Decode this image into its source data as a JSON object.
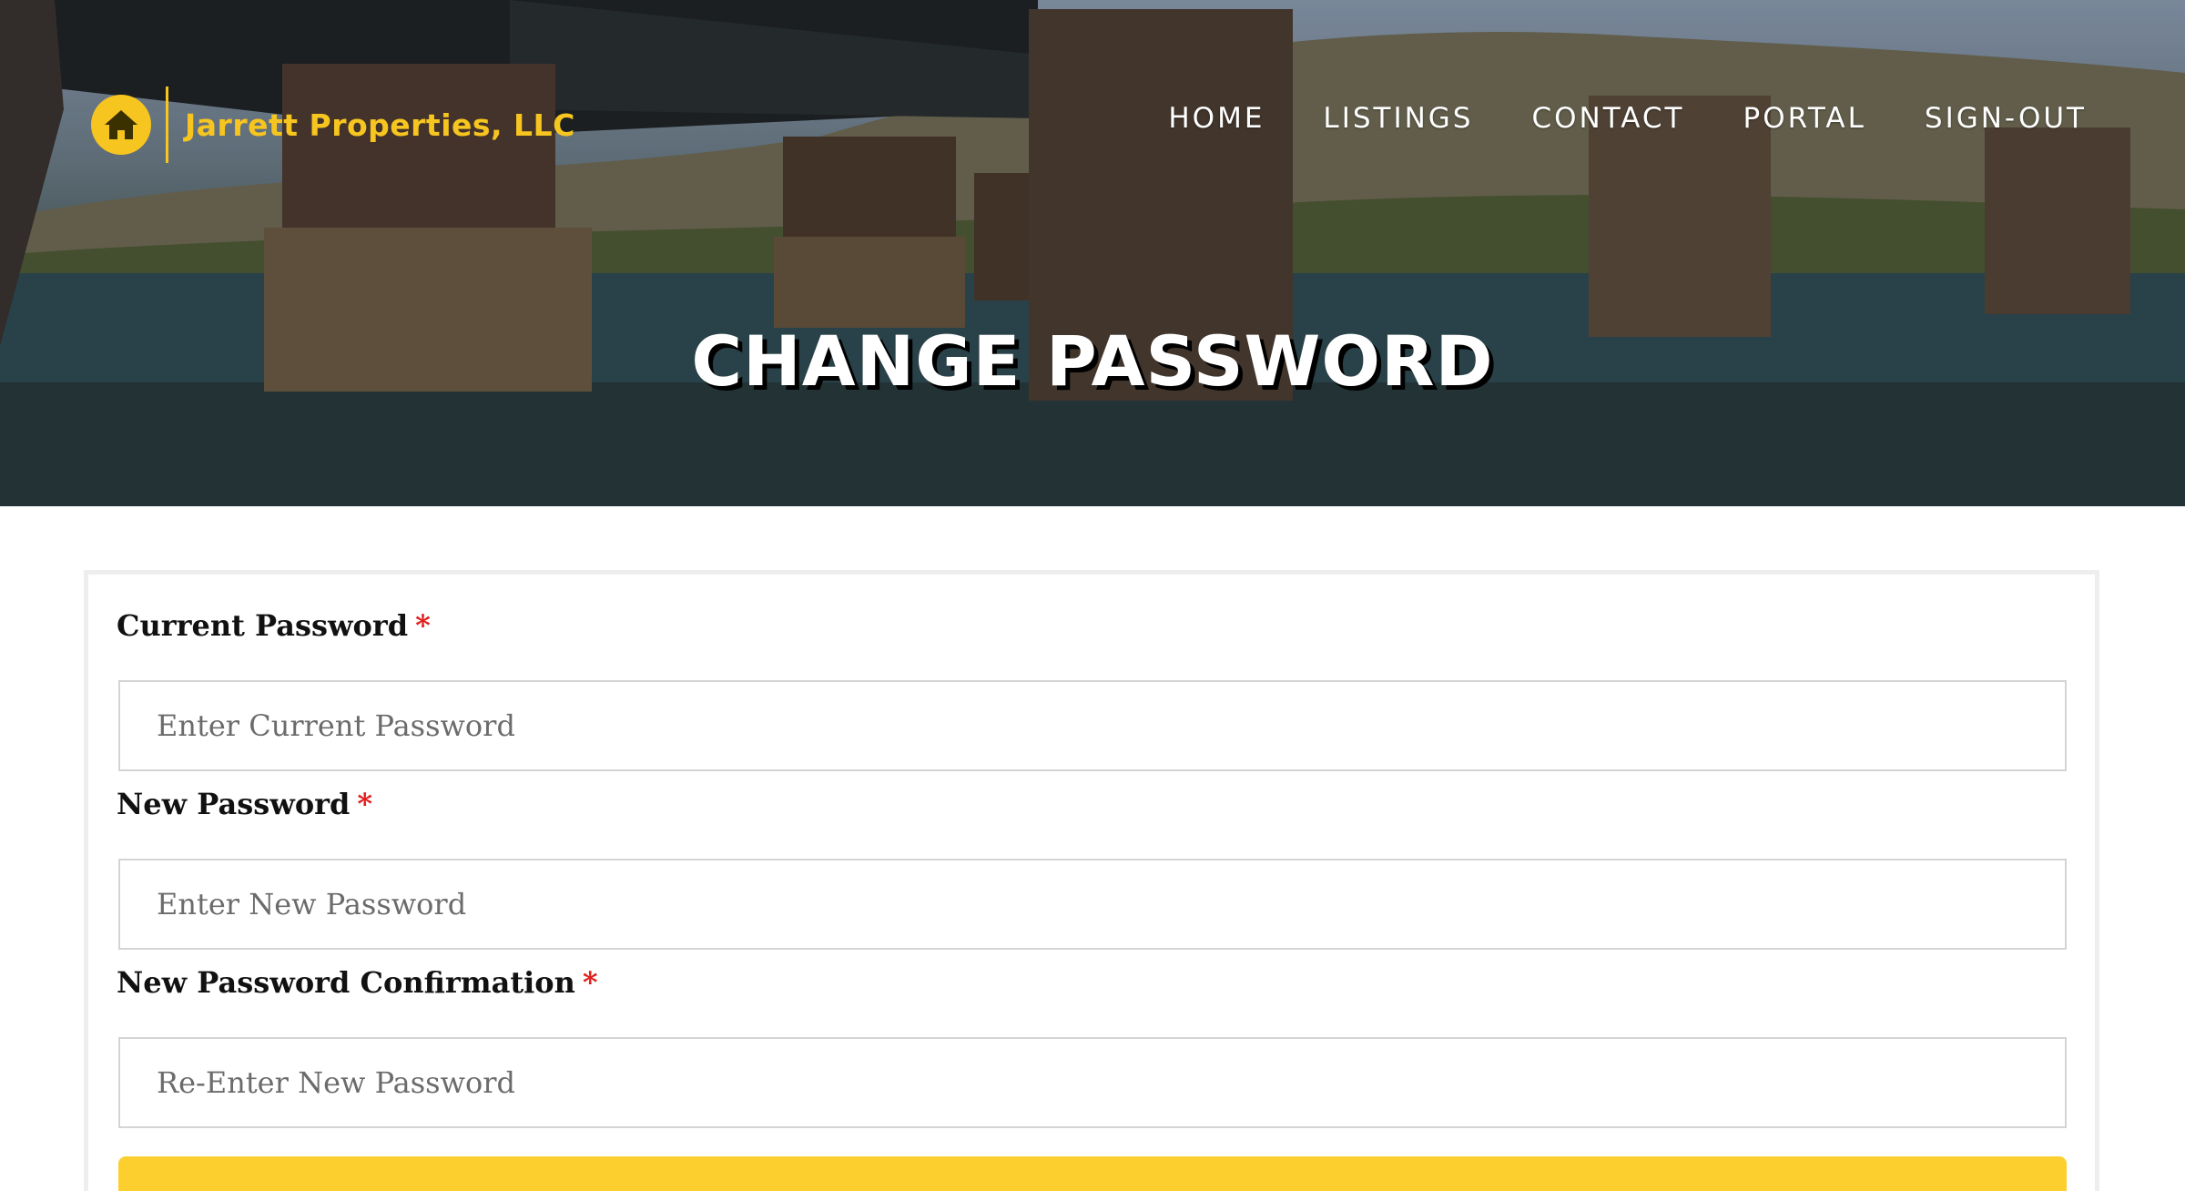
{
  "brand": {
    "name": "Jarrett Properties, LLC"
  },
  "nav": {
    "items": [
      {
        "label": "HOME"
      },
      {
        "label": "LISTINGS"
      },
      {
        "label": "CONTACT"
      },
      {
        "label": "PORTAL"
      },
      {
        "label": "SIGN-OUT"
      }
    ]
  },
  "hero": {
    "title": "CHANGE PASSWORD"
  },
  "form": {
    "current_password": {
      "label": "Current Password",
      "required_mark": "*",
      "placeholder": "Enter Current Password"
    },
    "new_password": {
      "label": "New Password",
      "required_mark": "*",
      "placeholder": "Enter New Password"
    },
    "confirm_password": {
      "label": "New Password Confirmation",
      "required_mark": "*",
      "placeholder": "Re-Enter New Password"
    }
  },
  "colors": {
    "accent": "#f7c51f",
    "button": "#fccf2e",
    "required": "#e31b1b"
  },
  "icons": {
    "brand_logo": "house-icon"
  }
}
